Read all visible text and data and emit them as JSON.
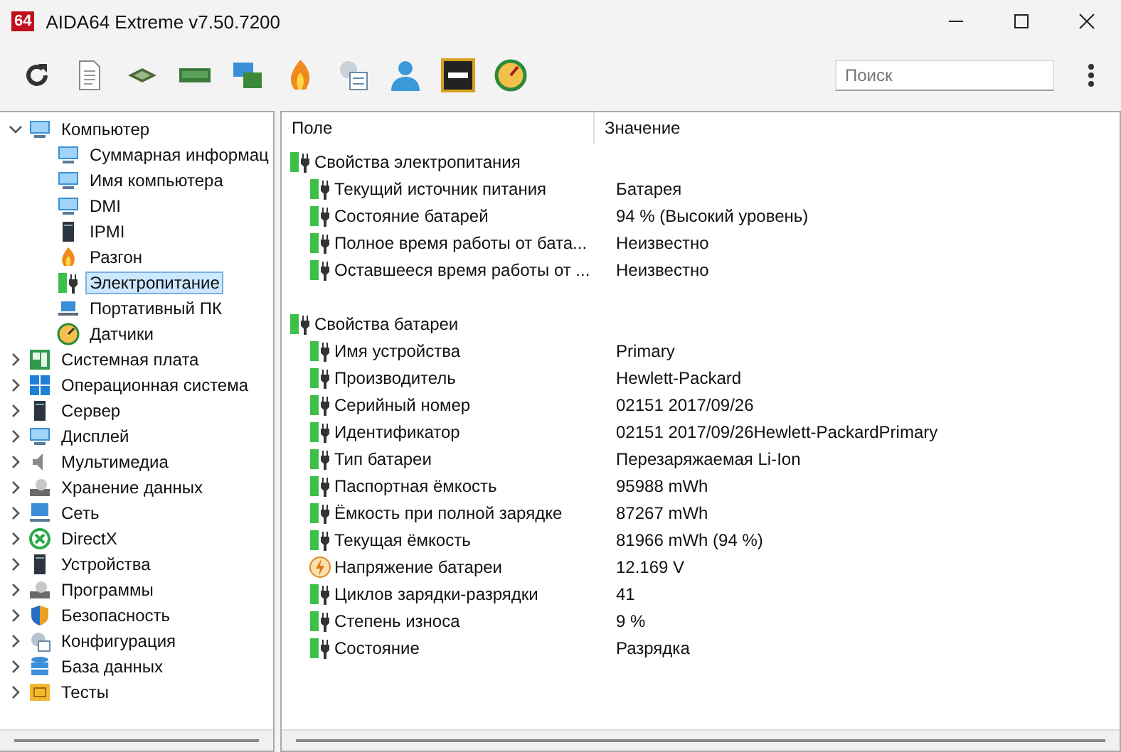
{
  "window": {
    "logo": "64",
    "title": "AIDA64 Extreme v7.50.7200"
  },
  "search": {
    "placeholder": "Поиск"
  },
  "tree": [
    {
      "label": "Компьютер",
      "expanded": true,
      "selected": false,
      "children": [
        {
          "label": "Суммарная информац",
          "selected": false
        },
        {
          "label": "Имя компьютера",
          "selected": false
        },
        {
          "label": "DMI",
          "selected": false
        },
        {
          "label": "IPMI",
          "selected": false
        },
        {
          "label": "Разгон",
          "selected": false
        },
        {
          "label": "Электропитание",
          "selected": true
        },
        {
          "label": "Портативный ПК",
          "selected": false
        },
        {
          "label": "Датчики",
          "selected": false
        }
      ]
    },
    {
      "label": "Системная плата",
      "expanded": false,
      "selected": false
    },
    {
      "label": "Операционная система",
      "expanded": false,
      "selected": false
    },
    {
      "label": "Сервер",
      "expanded": false,
      "selected": false
    },
    {
      "label": "Дисплей",
      "expanded": false,
      "selected": false
    },
    {
      "label": "Мультимедиа",
      "expanded": false,
      "selected": false
    },
    {
      "label": "Хранение данных",
      "expanded": false,
      "selected": false
    },
    {
      "label": "Сеть",
      "expanded": false,
      "selected": false
    },
    {
      "label": "DirectX",
      "expanded": false,
      "selected": false
    },
    {
      "label": "Устройства",
      "expanded": false,
      "selected": false
    },
    {
      "label": "Программы",
      "expanded": false,
      "selected": false
    },
    {
      "label": "Безопасность",
      "expanded": false,
      "selected": false
    },
    {
      "label": "Конфигурация",
      "expanded": false,
      "selected": false
    },
    {
      "label": "База данных",
      "expanded": false,
      "selected": false
    },
    {
      "label": "Тесты",
      "expanded": false,
      "selected": false
    }
  ],
  "table": {
    "columns": [
      "Поле",
      "Значение"
    ],
    "groups": [
      {
        "title": "Свойства электропитания",
        "rows": [
          {
            "kind": "power",
            "field": "Текущий источник питания",
            "value": "Батарея"
          },
          {
            "kind": "power",
            "field": "Состояние батарей",
            "value": "94 % (Высокий уровень)"
          },
          {
            "kind": "power",
            "field": "Полное время работы от бата...",
            "value": "Неизвестно"
          },
          {
            "kind": "power",
            "field": "Оставшееся время работы от ...",
            "value": "Неизвестно"
          }
        ]
      },
      {
        "title": "Свойства батареи",
        "rows": [
          {
            "kind": "power",
            "field": "Имя устройства",
            "value": "Primary"
          },
          {
            "kind": "power",
            "field": "Производитель",
            "value": "Hewlett-Packard"
          },
          {
            "kind": "power",
            "field": "Серийный номер",
            "value": "02151 2017/09/26"
          },
          {
            "kind": "power",
            "field": "Идентификатор",
            "value": "02151 2017/09/26Hewlett-PackardPrimary"
          },
          {
            "kind": "power",
            "field": "Тип батареи",
            "value": "Перезаряжаемая Li-Ion"
          },
          {
            "kind": "power",
            "field": "Паспортная ёмкость",
            "value": "95988 mWh"
          },
          {
            "kind": "power",
            "field": "Ёмкость при полной зарядке",
            "value": "87267 mWh"
          },
          {
            "kind": "power",
            "field": "Текущая ёмкость",
            "value": "81966 mWh  (94 %)"
          },
          {
            "kind": "voltage",
            "field": "Напряжение батареи",
            "value": "12.169 V"
          },
          {
            "kind": "power",
            "field": "Циклов зарядки-разрядки",
            "value": "41"
          },
          {
            "kind": "power",
            "field": "Степень износа",
            "value": "9 %"
          },
          {
            "kind": "power",
            "field": "Состояние",
            "value": "Разрядка"
          }
        ]
      }
    ]
  }
}
